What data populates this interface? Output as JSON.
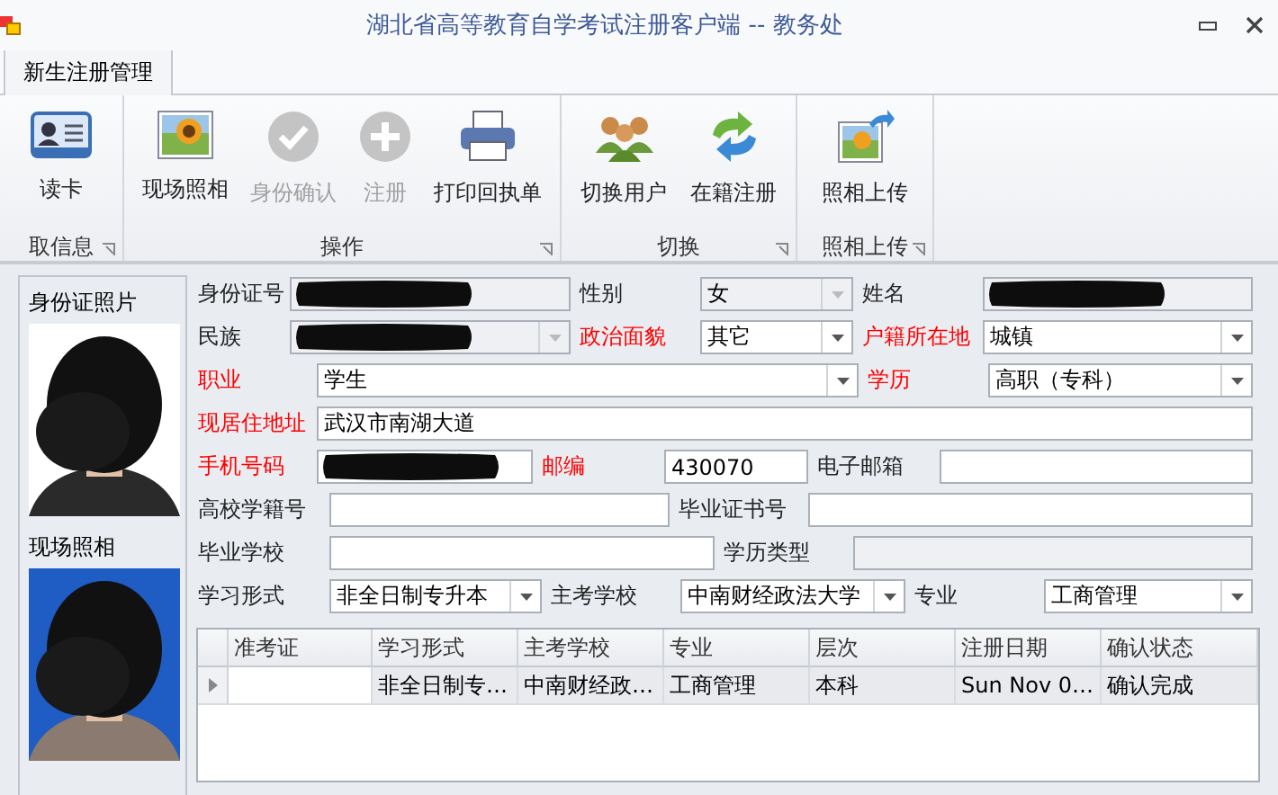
{
  "window": {
    "title": "湖北省高等教育自学考试注册客户端 -- 教务处"
  },
  "tabs": [
    {
      "label": "新生注册管理",
      "selected": true
    }
  ],
  "ribbon_groups": [
    {
      "label": "取信息",
      "buttons": [
        {
          "label": "读卡",
          "disabled": false
        }
      ]
    },
    {
      "label": "操作",
      "buttons": [
        {
          "label": "现场照相",
          "disabled": false
        },
        {
          "label": "身份确认",
          "disabled": true
        },
        {
          "label": "注册",
          "disabled": true
        },
        {
          "label": "打印回执单",
          "disabled": false
        }
      ]
    },
    {
      "label": "切换",
      "buttons": [
        {
          "label": "切换用户",
          "disabled": false
        },
        {
          "label": "在籍注册",
          "disabled": false
        }
      ]
    },
    {
      "label": "照相上传",
      "buttons": [
        {
          "label": "照相上传",
          "disabled": false
        }
      ]
    }
  ],
  "photos": [
    {
      "label": "身份证照片",
      "kind": "picture"
    },
    {
      "label": "现场照相",
      "kind": "picture"
    }
  ],
  "form_rows": [
    [
      {
        "label": "身份证号",
        "required": false,
        "kind": "text",
        "redacted": true,
        "disabled": true
      },
      {
        "label": "性别",
        "required": false,
        "kind": "combo",
        "value": "女",
        "disabled": true
      },
      {
        "label": "姓名",
        "required": false,
        "kind": "text",
        "redacted": true,
        "disabled": true
      }
    ],
    [
      {
        "label": "民族",
        "required": false,
        "kind": "combo",
        "redacted": true,
        "disabled": true
      },
      {
        "label": "政治面貌",
        "required": true,
        "kind": "combo",
        "value": "其它",
        "disabled": false
      },
      {
        "label": "户籍所在地",
        "required": true,
        "kind": "combo",
        "value": "城镇",
        "disabled": false
      }
    ],
    [
      {
        "label": "职业",
        "required": true,
        "kind": "combo",
        "value": "学生",
        "disabled": false
      },
      {
        "label": "学历",
        "required": true,
        "kind": "combo",
        "value": "高职（专科）",
        "disabled": false
      }
    ],
    [
      {
        "label": "现居住地址",
        "required": true,
        "kind": "text",
        "value": "武汉市南湖大道",
        "disabled": false
      }
    ],
    [
      {
        "label": "手机号码",
        "required": true,
        "kind": "text",
        "redacted": true,
        "disabled": false
      },
      {
        "label": "邮编",
        "required": true,
        "kind": "text",
        "value": "430070",
        "disabled": false
      },
      {
        "label": "电子邮箱",
        "required": false,
        "kind": "text",
        "disabled": false
      }
    ],
    [
      {
        "label": "高校学籍号",
        "required": false,
        "kind": "text",
        "disabled": false
      },
      {
        "label": "毕业证书号",
        "required": false,
        "kind": "text",
        "disabled": false
      }
    ],
    [
      {
        "label": "毕业学校",
        "required": false,
        "kind": "text",
        "disabled": false
      },
      {
        "label": "学历类型",
        "required": false,
        "kind": "text",
        "disabled": true
      }
    ],
    [
      {
        "label": "学习形式",
        "required": false,
        "kind": "combo",
        "value": "非全日制专升本",
        "disabled": false
      },
      {
        "label": "主考学校",
        "required": false,
        "kind": "combo",
        "value": "中南财经政法大学",
        "disabled": false
      },
      {
        "label": "专业",
        "required": false,
        "kind": "combo",
        "value": "工商管理",
        "disabled": false
      }
    ]
  ],
  "table": {
    "columns": [
      "准考证",
      "学习形式",
      "主考学校",
      "专业",
      "层次",
      "注册日期",
      "确认状态"
    ],
    "rows": [
      {
        "selected": true,
        "cells": [
          "",
          "非全日制专…",
          "中南财经政…",
          "工商管理",
          "本科",
          "Sun Nov 0…",
          "确认完成"
        ]
      }
    ]
  }
}
